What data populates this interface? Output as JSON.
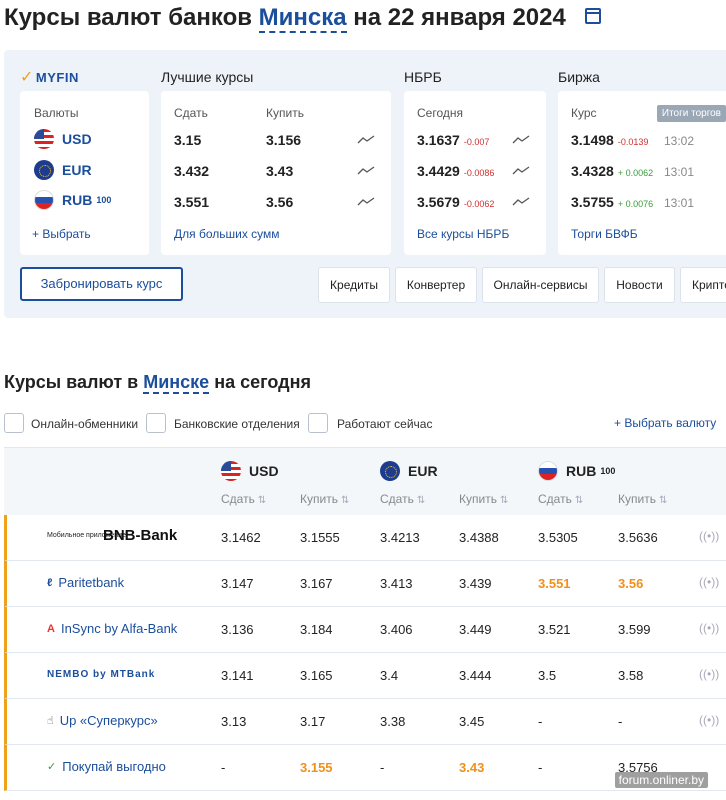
{
  "header": {
    "title_prefix": "Курсы валют банков",
    "city": "Минска",
    "title_suffix": "на 22 января 2024"
  },
  "logo": "MYFIN",
  "sections": {
    "best": "Лучшие курсы",
    "nbrb": "НБРБ",
    "exchange": "Биржа"
  },
  "currencies_card": {
    "label": "Валюты",
    "items": [
      {
        "code": "USD",
        "sup": ""
      },
      {
        "code": "EUR",
        "sup": ""
      },
      {
        "code": "RUB",
        "sup": "100"
      }
    ],
    "select_label": "+ Выбрать"
  },
  "best_card": {
    "sell_label": "Сдать",
    "buy_label": "Купить",
    "rows": [
      {
        "sell": "3.15",
        "buy": "3.156"
      },
      {
        "sell": "3.432",
        "buy": "3.43"
      },
      {
        "sell": "3.551",
        "buy": "3.56"
      }
    ],
    "link": "Для больших сумм"
  },
  "nbrb_card": {
    "label": "Сегодня",
    "rows": [
      {
        "value": "3.1637",
        "change": "-0.007"
      },
      {
        "value": "3.4429",
        "change": "-0.0086"
      },
      {
        "value": "3.5679",
        "change": "-0.0062"
      }
    ],
    "link": "Все курсы НБРБ"
  },
  "exchange_card": {
    "label": "Курс",
    "badge": "Итоги торгов",
    "rows": [
      {
        "value": "3.1498",
        "change": "-0.0139",
        "time": "13:02",
        "dir": "neg"
      },
      {
        "value": "3.4328",
        "change": "+ 0.0062",
        "time": "13:01",
        "dir": "pos"
      },
      {
        "value": "3.5755",
        "change": "+ 0.0076",
        "time": "13:01",
        "dir": "pos"
      }
    ],
    "link": "Торги БВФБ"
  },
  "book_button": "Забронировать курс",
  "nav": [
    "Кредиты",
    "Конвертер",
    "Онлайн-сервисы",
    "Новости",
    "Крипто"
  ],
  "section2": {
    "title_prefix": "Курсы валют в",
    "city": "Минске",
    "title_suffix": "на сегодня",
    "filters": [
      "Онлайн-обменники",
      "Банковские отделения",
      "Работают сейчас"
    ],
    "add_currency": "+ Выбрать валюту"
  },
  "table": {
    "currencies": [
      {
        "code": "USD",
        "sup": ""
      },
      {
        "code": "EUR",
        "sup": ""
      },
      {
        "code": "RUB",
        "sup": "100"
      }
    ],
    "sell_label": "Сдать",
    "buy_label": "Купить",
    "rows": [
      {
        "bank": "BNB-Bank",
        "bank_note": "Мобильное приложение",
        "cells": [
          "3.1462",
          "3.1555",
          "3.4213",
          "3.4388",
          "3.5305",
          "3.5636"
        ],
        "best": []
      },
      {
        "bank": "Paritetbank",
        "cells": [
          "3.147",
          "3.167",
          "3.413",
          "3.439",
          "3.551",
          "3.56"
        ],
        "best": [
          4,
          5
        ]
      },
      {
        "bank": "InSync by Alfa-Bank",
        "cells": [
          "3.136",
          "3.184",
          "3.406",
          "3.449",
          "3.521",
          "3.599"
        ],
        "best": []
      },
      {
        "bank": "NEMBO by MTBank",
        "cells": [
          "3.141",
          "3.165",
          "3.4",
          "3.444",
          "3.5",
          "3.58"
        ],
        "best": []
      },
      {
        "bank": "Up «Суперкурс»",
        "cells": [
          "3.13",
          "3.17",
          "3.38",
          "3.45",
          "-",
          "-"
        ],
        "best": []
      },
      {
        "bank": "Покупай выгодно",
        "cells": [
          "-",
          "3.155",
          "-",
          "3.43",
          "-",
          "3.5756"
        ],
        "best": [
          1,
          3
        ]
      }
    ]
  },
  "watermark": "forum.onliner.by",
  "colors": {
    "accent": "#1b4e9b",
    "highlight": "#f0a11a",
    "negative": "#d0302f",
    "positive": "#3a9b3a"
  }
}
